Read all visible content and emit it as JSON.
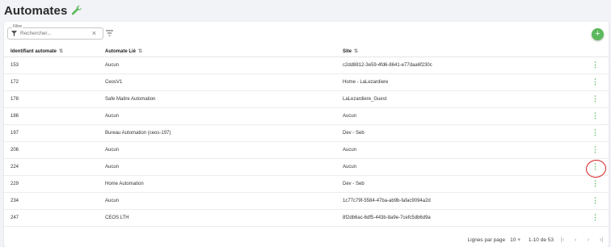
{
  "page": {
    "title": "Automates"
  },
  "toolbar": {
    "filter_legend": "Filtre",
    "filter_placeholder": "Rechercher...",
    "add_label": "+"
  },
  "table": {
    "columns": [
      "Identifiant automate",
      "Automate Lié",
      "Site"
    ],
    "rows": [
      {
        "id": "153",
        "linked": "Aucun",
        "site": "c2dd8812-3e59-4fd6-8641-e77daa6f230c"
      },
      {
        "id": "172",
        "linked": "CeosV1",
        "site": "Home - LaLezardiere"
      },
      {
        "id": "178",
        "linked": "Safe Maitre Automation",
        "site": "LaLezardiere_Guest"
      },
      {
        "id": "186",
        "linked": "Aucun",
        "site": "Aucun"
      },
      {
        "id": "197",
        "linked": "Bureau Automation (ceos-197)",
        "site": "Dev - Seb"
      },
      {
        "id": "206",
        "linked": "Aucun",
        "site": "Aucun"
      },
      {
        "id": "224",
        "linked": "Aucun",
        "site": "Aucun"
      },
      {
        "id": "229",
        "linked": "Home Automation",
        "site": "Dev - Seb"
      },
      {
        "id": "234",
        "linked": "Aucun",
        "site": "1c77c79f-5584-47ba-ab9b-fafac9094a2d"
      },
      {
        "id": "247",
        "linked": "CEOS LTH",
        "site": "8f2db6ac-6df5-443b-8a9e-7cefc5db6d9a"
      }
    ]
  },
  "pagination": {
    "rows_per_page_label": "Lignes par page",
    "rows_per_page_value": "10",
    "range_text": "1-10 de 53"
  },
  "colors": {
    "accent": "#5cb85c",
    "annotation": "#d62020"
  }
}
